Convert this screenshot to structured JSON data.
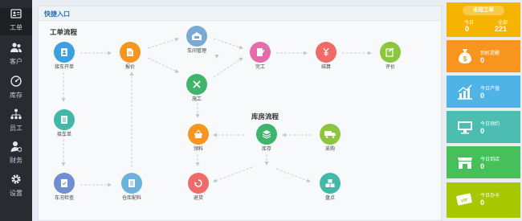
{
  "sidebar": {
    "items": [
      {
        "label": "工单",
        "icon": "id-card-icon"
      },
      {
        "label": "客户",
        "icon": "customers-icon"
      },
      {
        "label": "库存",
        "icon": "speedometer-icon"
      },
      {
        "label": "员工",
        "icon": "org-chart-icon"
      },
      {
        "label": "财务",
        "icon": "finance-person-icon"
      },
      {
        "label": "设置",
        "icon": "gear-icon"
      }
    ]
  },
  "panel": {
    "title": "快捷入口",
    "work_flow_title": "工单流程",
    "warehouse_flow_title": "库房流程"
  },
  "nodes": {
    "receive": {
      "label": "接车开单",
      "color": "#3b9fe0",
      "icon": "contact-book-icon"
    },
    "quote": {
      "label": "报价",
      "color": "#f7951e",
      "icon": "document-icon"
    },
    "garage": {
      "label": "车间管理",
      "color": "#7aa9d6",
      "icon": "garage-icon"
    },
    "construct": {
      "label": "施工",
      "color": "#3fb56b",
      "icon": "tools-icon"
    },
    "complete": {
      "label": "完工",
      "color": "#e86aa8",
      "icon": "pencil-icon"
    },
    "settle": {
      "label": "结算",
      "color": "#ef6b67",
      "icon": "yen-icon"
    },
    "review": {
      "label": "评价",
      "color": "#8cc63f",
      "icon": "edit-check-icon"
    },
    "pickup": {
      "label": "接车单",
      "color": "#43b8a8",
      "icon": "list-icon"
    },
    "inspect": {
      "label": "车况检查",
      "color": "#6f8fd0",
      "icon": "clipboard-check-icon"
    },
    "storeparts": {
      "label": "仓库配料",
      "color": "#6ab2dc",
      "icon": "clipboard-list-icon"
    },
    "material": {
      "label": "领料",
      "color": "#f7951e",
      "icon": "basket-icon"
    },
    "stock": {
      "label": "库存",
      "color": "#3fb56b",
      "icon": "layers-icon"
    },
    "purchase": {
      "label": "采购",
      "color": "#8cc63f",
      "icon": "truck-icon"
    },
    "return": {
      "label": "退货",
      "color": "#ef6b67",
      "icon": "return-icon"
    },
    "inventory": {
      "label": "盘点",
      "color": "#43b8a8",
      "icon": "boxes-icon"
    }
  },
  "cards": {
    "pending": {
      "tag": "未结工单",
      "today_label": "今日",
      "today_value": "0",
      "total_label": "全部",
      "total_value": "221",
      "color": "#f6b400"
    },
    "stats": [
      {
        "title": "到机提醒",
        "value": "0",
        "color": "#f7951e",
        "icon": "money-bag-icon"
      },
      {
        "title": "今日产值",
        "value": "0",
        "color": "#4fb3e6",
        "icon": "growth-chart-icon"
      },
      {
        "title": "今日预约",
        "value": "0",
        "color": "#4dbdb1",
        "icon": "monitor-icon"
      },
      {
        "title": "今日到店",
        "value": "0",
        "color": "#45c05a",
        "icon": "storefront-icon"
      },
      {
        "title": "今日办卡",
        "value": "0",
        "color": "#a7c700",
        "icon": "vip-card-icon"
      }
    ]
  }
}
